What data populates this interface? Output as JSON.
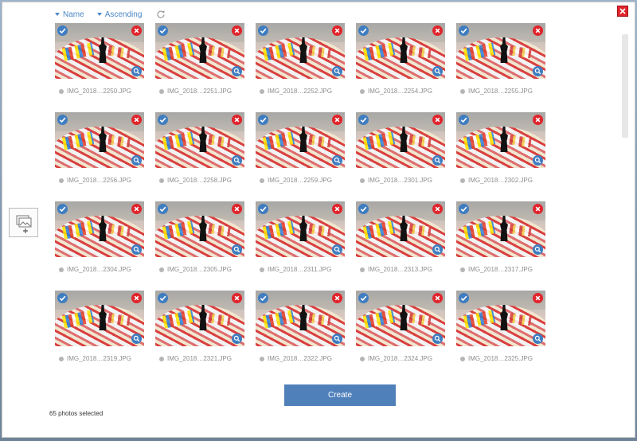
{
  "sort": {
    "field_label": "Name",
    "order_label": "Ascending"
  },
  "photos": [
    {
      "name": "IMG_2018…2250.JPG"
    },
    {
      "name": "IMG_2018…2251.JPG"
    },
    {
      "name": "IMG_2018…2252.JPG"
    },
    {
      "name": "IMG_2018…2254.JPG"
    },
    {
      "name": "IMG_2018…2255.JPG"
    },
    {
      "name": "IMG_2018…2256.JPG"
    },
    {
      "name": "IMG_2018…2258.JPG"
    },
    {
      "name": "IMG_2018…2259.JPG"
    },
    {
      "name": "IMG_2018…2301.JPG"
    },
    {
      "name": "IMG_2018…2302.JPG"
    },
    {
      "name": "IMG_2018…2304.JPG"
    },
    {
      "name": "IMG_2018…2305.JPG"
    },
    {
      "name": "IMG_2018…2311.JPG"
    },
    {
      "name": "IMG_2018…2313.JPG"
    },
    {
      "name": "IMG_2018…2317.JPG"
    },
    {
      "name": "IMG_2018…2319.JPG"
    },
    {
      "name": "IMG_2018…2321.JPG"
    },
    {
      "name": "IMG_2018…2322.JPG"
    },
    {
      "name": "IMG_2018…2324.JPG"
    },
    {
      "name": "IMG_2018…2325.JPG"
    }
  ],
  "footer": {
    "create_label": "Create",
    "status_text": "65 photos selected"
  },
  "icons": {
    "sort_caret": "caret-down-icon",
    "refresh": "refresh-icon",
    "close": "close-icon",
    "add_photos": "add-photos-icon",
    "select": "check-icon",
    "remove": "remove-icon",
    "zoom": "magnifier-icon"
  },
  "colors": {
    "accent": "#4f80ba",
    "close_red": "#e0242b",
    "badge_blue": "#3f7dc0"
  }
}
